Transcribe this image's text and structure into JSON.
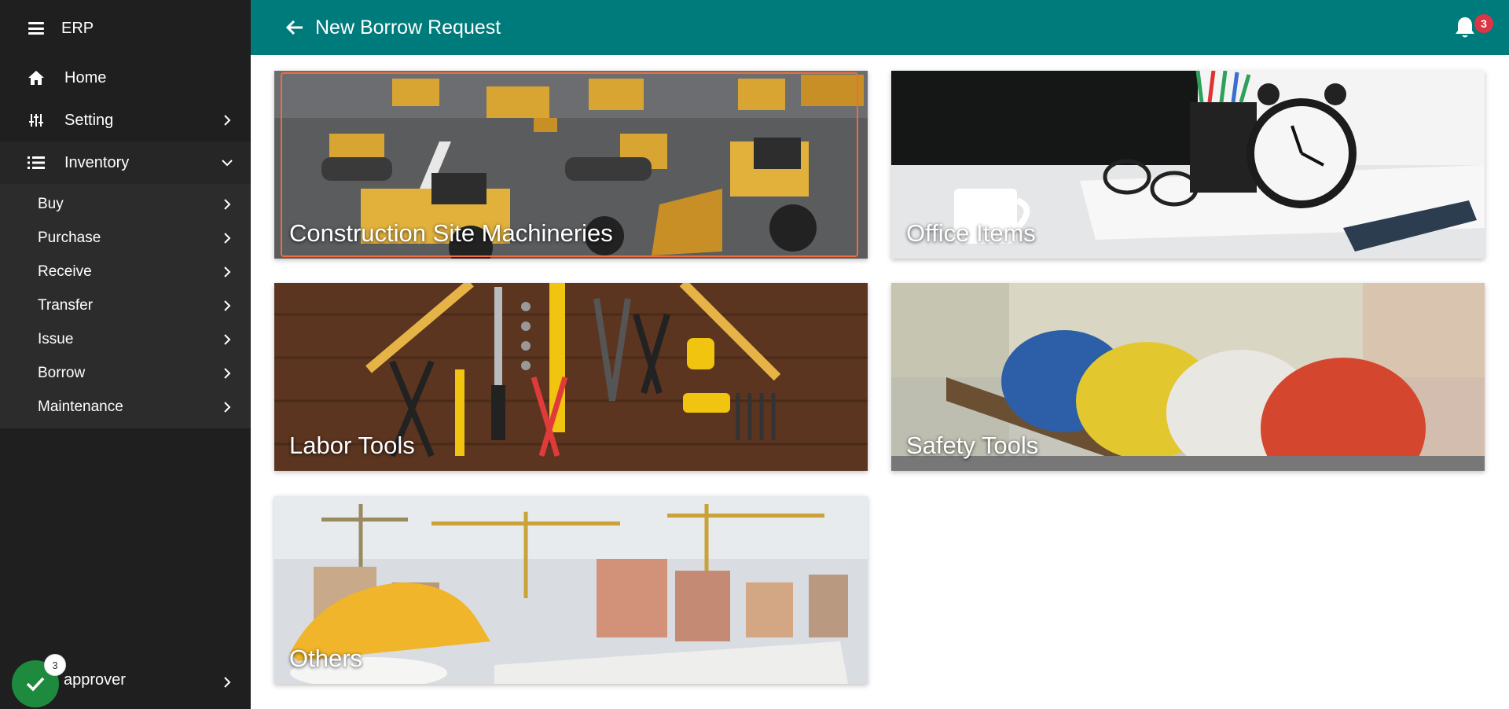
{
  "app": {
    "name": "ERP"
  },
  "header": {
    "title": "New Borrow Request",
    "notification_count": "3"
  },
  "sidebar": {
    "items": [
      {
        "label": "Home",
        "icon": "home-icon"
      },
      {
        "label": "Setting",
        "icon": "sliders-icon"
      },
      {
        "label": "Inventory",
        "icon": "list-icon",
        "expanded": true
      }
    ],
    "inventory_submenu": [
      {
        "label": "Buy"
      },
      {
        "label": "Purchase"
      },
      {
        "label": "Receive"
      },
      {
        "label": "Transfer"
      },
      {
        "label": "Issue"
      },
      {
        "label": "Borrow"
      },
      {
        "label": "Maintenance"
      }
    ],
    "user": {
      "name": "approver",
      "badge_count": "3",
      "status_icon": "check-icon"
    }
  },
  "categories": [
    {
      "label": "Construction Site Machineries",
      "image": "construction-machinery-photo",
      "selected": true
    },
    {
      "label": "Office Items",
      "image": "office-desk-clock-photo"
    },
    {
      "label": "Labor Tools",
      "image": "hand-tools-on-wood-photo"
    },
    {
      "label": "Safety Tools",
      "image": "hard-hats-photo"
    },
    {
      "label": "Others",
      "image": "construction-cranes-helmet-photo"
    }
  ],
  "colors": {
    "header": "#007b7b",
    "sidebar": "#1f1f1f",
    "submenu": "#2c2c2c",
    "selection": "#f26b3a",
    "badge": "#dc3545",
    "user_status": "#1e8a3e"
  }
}
